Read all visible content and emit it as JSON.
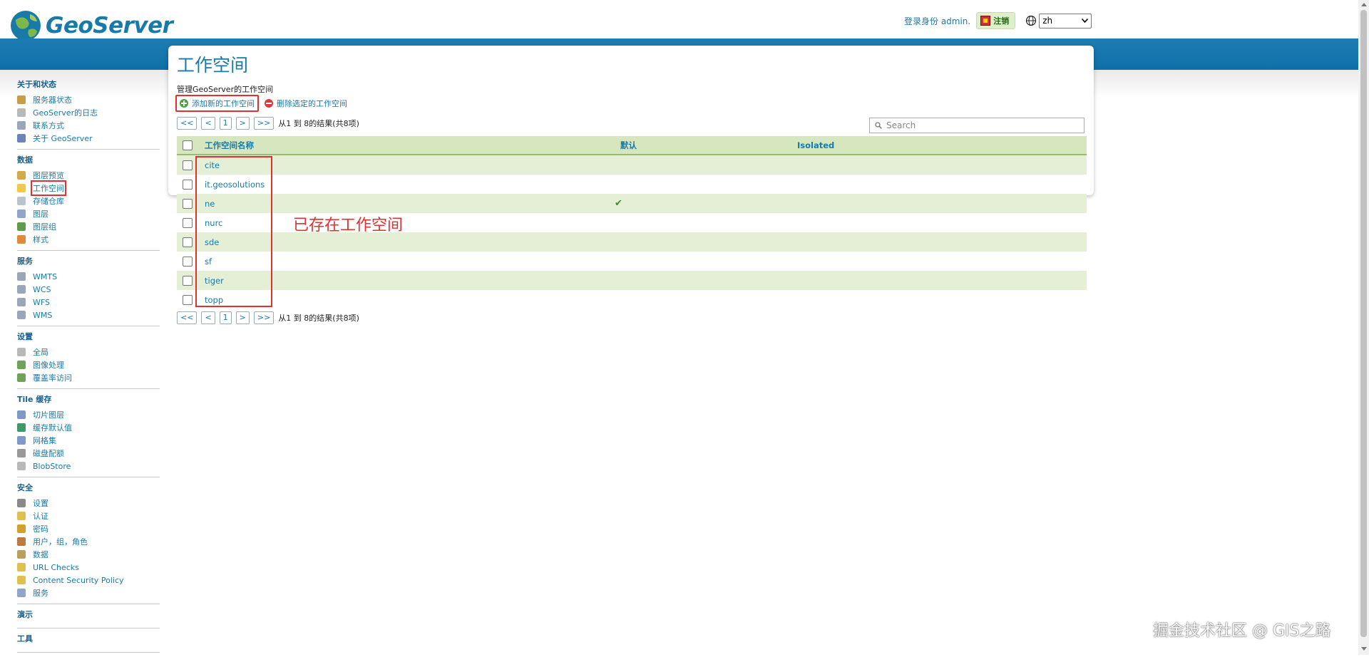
{
  "header": {
    "logo_text": "GeoServer",
    "login_text": "登录身份 admin.",
    "logout_label": "注销",
    "language": "zh"
  },
  "sidebar": {
    "sections": [
      {
        "title": "关于和状态",
        "items": [
          {
            "label": "服务器状态",
            "icon": "server-status-icon",
            "color": "#c99b4a"
          },
          {
            "label": "GeoServer的日志",
            "icon": "log-icon",
            "color": "#b9b9b9"
          },
          {
            "label": "联系方式",
            "icon": "contact-icon",
            "color": "#9aa7b8"
          },
          {
            "label": "关于 GeoServer",
            "icon": "about-icon",
            "color": "#6a86b8"
          }
        ]
      },
      {
        "title": "数据",
        "items": [
          {
            "label": "图层预览",
            "icon": "layer-preview-icon",
            "color": "#d4a94a"
          },
          {
            "label": "工作空间",
            "icon": "folder-icon",
            "color": "#f0c94a",
            "active": true
          },
          {
            "label": "存储仓库",
            "icon": "store-icon",
            "color": "#b9c4cf"
          },
          {
            "label": "图层",
            "icon": "layer-icon",
            "color": "#8fa5c9"
          },
          {
            "label": "图层组",
            "icon": "layer-group-icon",
            "color": "#5f9b4a"
          },
          {
            "label": "样式",
            "icon": "style-icon",
            "color": "#e08a3a"
          }
        ]
      },
      {
        "title": "服务",
        "items": [
          {
            "label": "WMTS",
            "icon": "wmts-icon",
            "color": "#9aa7b8"
          },
          {
            "label": "WCS",
            "icon": "wcs-icon",
            "color": "#9aa7b8"
          },
          {
            "label": "WFS",
            "icon": "wfs-icon",
            "color": "#9aa7b8"
          },
          {
            "label": "WMS",
            "icon": "wms-icon",
            "color": "#9aa7b8"
          }
        ]
      },
      {
        "title": "设置",
        "items": [
          {
            "label": "全局",
            "icon": "global-settings-icon",
            "color": "#b9b9b9"
          },
          {
            "label": "图像处理",
            "icon": "image-processing-icon",
            "color": "#6fa35a"
          },
          {
            "label": "覆盖率访问",
            "icon": "coverage-access-icon",
            "color": "#6fa35a"
          }
        ]
      },
      {
        "title": "Tile 缓存",
        "items": [
          {
            "label": "切片图层",
            "icon": "tile-layers-icon",
            "color": "#7f97c9"
          },
          {
            "label": "缓存默认值",
            "icon": "cache-defaults-icon",
            "color": "#3f9a6a"
          },
          {
            "label": "网格集",
            "icon": "gridsets-icon",
            "color": "#7f97c9"
          },
          {
            "label": "磁盘配额",
            "icon": "disk-quota-icon",
            "color": "#999999"
          },
          {
            "label": "BlobStore",
            "icon": "blobstore-icon",
            "color": "#b9b9b9"
          }
        ]
      },
      {
        "title": "安全",
        "items": [
          {
            "label": "设置",
            "icon": "wrench-icon",
            "color": "#8a8a8a"
          },
          {
            "label": "认证",
            "icon": "shield-icon",
            "color": "#e0c050"
          },
          {
            "label": "密码",
            "icon": "lock-icon",
            "color": "#d4a030"
          },
          {
            "label": "用户，组，角色",
            "icon": "users-icon",
            "color": "#c07a40"
          },
          {
            "label": "数据",
            "icon": "data-security-icon",
            "color": "#b9a060"
          },
          {
            "label": "URL Checks",
            "icon": "url-checks-icon",
            "color": "#e0c050"
          },
          {
            "label": "Content Security Policy",
            "icon": "csp-icon",
            "color": "#e0c050"
          },
          {
            "label": "服务",
            "icon": "service-security-icon",
            "color": "#8fa5c9"
          }
        ]
      },
      {
        "title": "演示",
        "items": []
      },
      {
        "title": "工具",
        "items": []
      }
    ]
  },
  "main": {
    "title": "工作空间",
    "description": "管理GeoServer的工作空间",
    "add_label": "添加新的工作空间",
    "remove_label": "删除选定的工作空间",
    "pager": {
      "first": "<<",
      "prev": "<",
      "page": "1",
      "next": ">",
      "last": ">>",
      "summary": "从1 到 8的结果(共8项)"
    },
    "search_placeholder": "Search",
    "table": {
      "columns": [
        "工作空间名称",
        "默认",
        "Isolated"
      ],
      "rows": [
        {
          "name": "cite",
          "default": false
        },
        {
          "name": "it.geosolutions",
          "default": false
        },
        {
          "name": "ne",
          "default": true
        },
        {
          "name": "nurc",
          "default": false
        },
        {
          "name": "sde",
          "default": false
        },
        {
          "name": "sf",
          "default": false
        },
        {
          "name": "tiger",
          "default": false
        },
        {
          "name": "topp",
          "default": false
        }
      ]
    },
    "annotation": "已存在工作空间"
  },
  "watermark": "掘金技术社区 @ GIS之路"
}
